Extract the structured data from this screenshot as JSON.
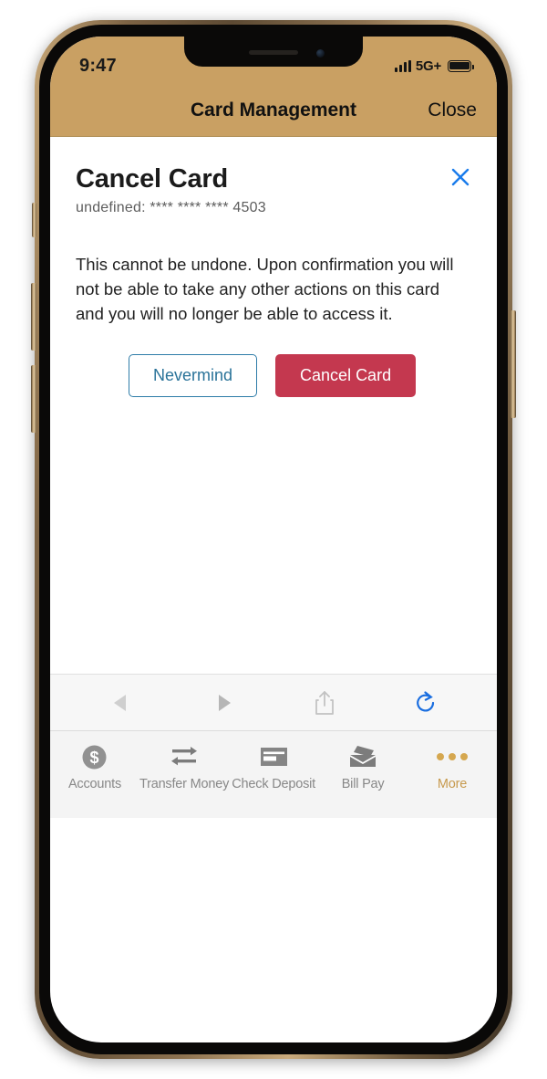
{
  "status_bar": {
    "time": "9:47",
    "network": "5G+",
    "signal_icon": "signal-bars-icon",
    "battery_icon": "battery-full-icon"
  },
  "nav_header": {
    "title": "Card Management",
    "close_label": "Close"
  },
  "modal": {
    "title": "Cancel Card",
    "subtitle": "undefined: **** **** **** 4503",
    "body": "This cannot be undone. Upon confirmation you will not be able to take any other actions on this card and you will no longer be able to access it.",
    "close_icon": "close-x-icon",
    "buttons": {
      "secondary_label": "Nevermind",
      "primary_label": "Cancel Card"
    }
  },
  "browser_toolbar": {
    "items": [
      {
        "name": "back-icon",
        "label": "Back"
      },
      {
        "name": "forward-icon",
        "label": "Forward"
      },
      {
        "name": "share-icon",
        "label": "Share"
      },
      {
        "name": "reload-icon",
        "label": "Reload"
      }
    ]
  },
  "tab_bar": {
    "items": [
      {
        "label": "Accounts",
        "icon": "dollar-circle-icon",
        "active": false
      },
      {
        "label": "Transfer Money",
        "icon": "transfer-arrows-icon",
        "active": false
      },
      {
        "label": "Check Deposit",
        "icon": "check-card-icon",
        "active": false
      },
      {
        "label": "Bill Pay",
        "icon": "envelope-icon",
        "active": false
      },
      {
        "label": "More",
        "icon": "more-dots-icon",
        "active": true
      }
    ]
  },
  "colors": {
    "header_gold": "#c9a063",
    "danger_red": "#c4384f",
    "link_blue": "#2a7399",
    "accent_gold": "#c79a4e",
    "close_x_blue": "#1a7ceb"
  }
}
